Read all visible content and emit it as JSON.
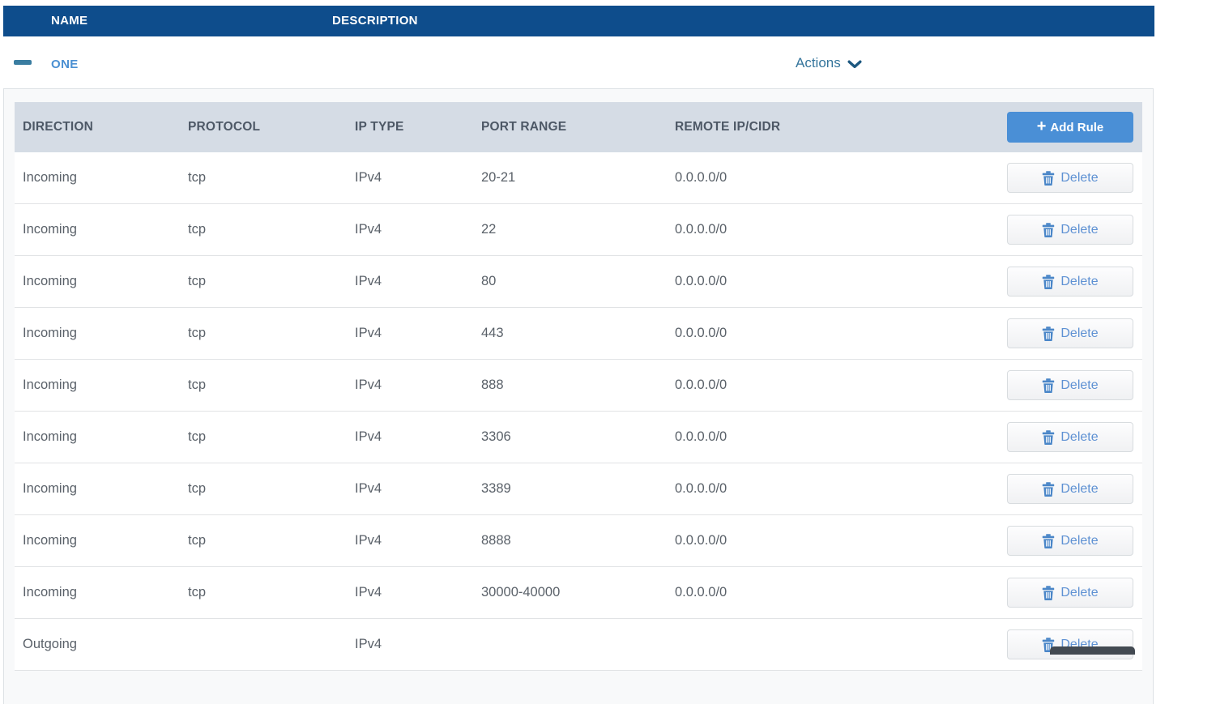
{
  "colors": {
    "header_bar_blue": "#0e4d8c",
    "link_blue": "#4a8fd2",
    "add_rule_blue": "#4a8fd6",
    "delete_text_blue": "#5e91d3",
    "table_header_band": "#d5dce5"
  },
  "outer_table": {
    "columns": [
      "NAME",
      "DESCRIPTION"
    ]
  },
  "group_row": {
    "name": "ONE",
    "actions_label": "Actions"
  },
  "rules_table": {
    "headers": [
      "DIRECTION",
      "PROTOCOL",
      "IP TYPE",
      "PORT RANGE",
      "REMOTE IP/CIDR"
    ],
    "add_rule_label": "Add Rule",
    "plus_glyph": "+",
    "delete_label": "Delete",
    "rows": [
      {
        "direction": "Incoming",
        "protocol": "tcp",
        "ip_type": "IPv4",
        "port_range": "20-21",
        "remote_ip_cidr": "0.0.0.0/0"
      },
      {
        "direction": "Incoming",
        "protocol": "tcp",
        "ip_type": "IPv4",
        "port_range": "22",
        "remote_ip_cidr": "0.0.0.0/0"
      },
      {
        "direction": "Incoming",
        "protocol": "tcp",
        "ip_type": "IPv4",
        "port_range": "80",
        "remote_ip_cidr": "0.0.0.0/0"
      },
      {
        "direction": "Incoming",
        "protocol": "tcp",
        "ip_type": "IPv4",
        "port_range": "443",
        "remote_ip_cidr": "0.0.0.0/0"
      },
      {
        "direction": "Incoming",
        "protocol": "tcp",
        "ip_type": "IPv4",
        "port_range": "888",
        "remote_ip_cidr": "0.0.0.0/0"
      },
      {
        "direction": "Incoming",
        "protocol": "tcp",
        "ip_type": "IPv4",
        "port_range": "3306",
        "remote_ip_cidr": "0.0.0.0/0"
      },
      {
        "direction": "Incoming",
        "protocol": "tcp",
        "ip_type": "IPv4",
        "port_range": "3389",
        "remote_ip_cidr": "0.0.0.0/0"
      },
      {
        "direction": "Incoming",
        "protocol": "tcp",
        "ip_type": "IPv4",
        "port_range": "8888",
        "remote_ip_cidr": "0.0.0.0/0"
      },
      {
        "direction": "Incoming",
        "protocol": "tcp",
        "ip_type": "IPv4",
        "port_range": "30000-40000",
        "remote_ip_cidr": "0.0.0.0/0"
      },
      {
        "direction": "Outgoing",
        "protocol": "",
        "ip_type": "IPv4",
        "port_range": "",
        "remote_ip_cidr": ""
      }
    ]
  }
}
